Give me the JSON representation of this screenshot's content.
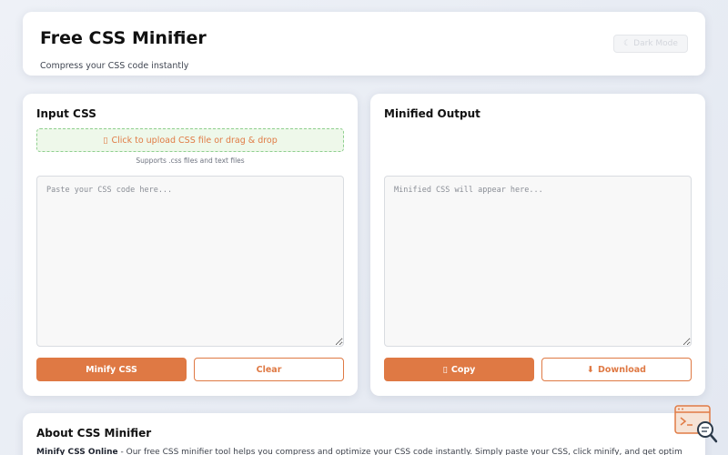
{
  "header": {
    "title": "Free CSS Minifier",
    "subtitle": "Compress your CSS code instantly",
    "dark_mode_label": "Dark Mode",
    "dark_mode_icon": "moon-icon"
  },
  "input_panel": {
    "title": "Input CSS",
    "upload_label": "Click to upload CSS file or drag & drop",
    "upload_icon": "folder-icon",
    "upload_note": "Supports .css files and text files",
    "textarea_placeholder": "Paste your CSS code here...",
    "minify_label": "Minify CSS",
    "clear_label": "Clear"
  },
  "output_panel": {
    "title": "Minified Output",
    "textarea_placeholder": "Minified CSS will appear here...",
    "copy_label": "Copy",
    "copy_icon": "clipboard-icon",
    "download_label": "Download",
    "download_icon": "download-arrow-icon"
  },
  "about": {
    "title": "About CSS Minifier",
    "lead": "Minify CSS Online",
    "text": " - Our free CSS minifier tool helps you compress and optimize your CSS code instantly. Simply paste your CSS, click minify, and get optimized"
  },
  "colors": {
    "accent": "#df7944",
    "upload_border": "#8fcf8f",
    "upload_bg": "#eef8ea"
  }
}
